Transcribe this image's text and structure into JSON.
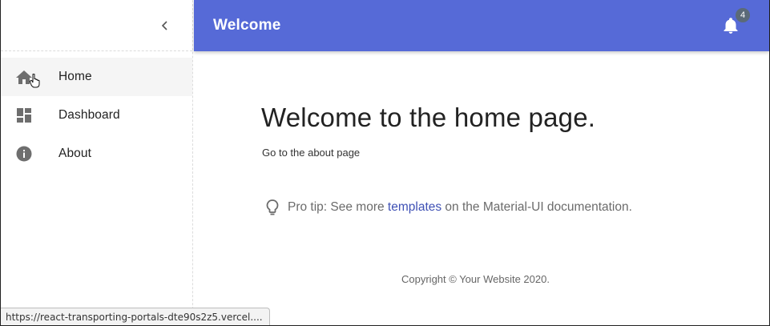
{
  "sidebar": {
    "collapse_icon": "chevron-left-icon",
    "items": [
      {
        "label": "Home",
        "icon": "home-icon",
        "active": true
      },
      {
        "label": "Dashboard",
        "icon": "dashboard-icon",
        "active": false
      },
      {
        "label": "About",
        "icon": "info-icon",
        "active": false
      }
    ]
  },
  "appbar": {
    "title": "Welcome",
    "notifications_count": "4",
    "bell_icon": "bell-icon",
    "color": "#566ad7"
  },
  "main": {
    "heading": "Welcome to the home page.",
    "about_link": "Go to the about page",
    "tip_prefix": "Pro tip: See more ",
    "tip_link": "templates",
    "tip_suffix": " on the Material-UI documentation.",
    "copyright": "Copyright © Your Website 2020."
  },
  "status_bar": {
    "url": "https://react-transporting-portals-dte90s2z5.vercel...."
  }
}
